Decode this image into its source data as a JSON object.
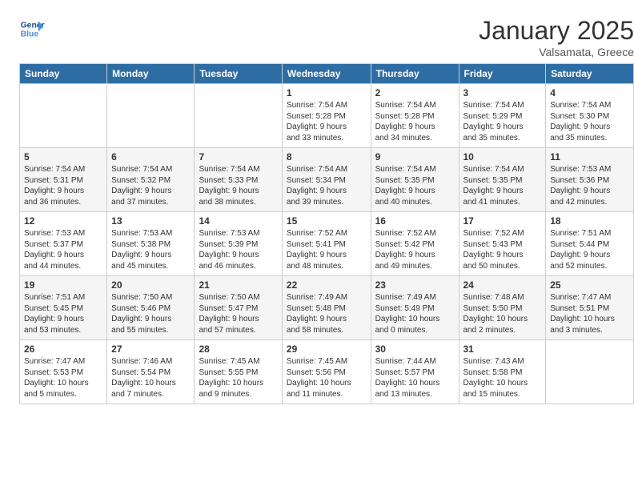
{
  "header": {
    "logo_line1": "General",
    "logo_line2": "Blue",
    "month": "January 2025",
    "location": "Valsamata, Greece"
  },
  "weekdays": [
    "Sunday",
    "Monday",
    "Tuesday",
    "Wednesday",
    "Thursday",
    "Friday",
    "Saturday"
  ],
  "weeks": [
    [
      {
        "day": "",
        "info": ""
      },
      {
        "day": "",
        "info": ""
      },
      {
        "day": "",
        "info": ""
      },
      {
        "day": "1",
        "info": "Sunrise: 7:54 AM\nSunset: 5:28 PM\nDaylight: 9 hours\nand 33 minutes."
      },
      {
        "day": "2",
        "info": "Sunrise: 7:54 AM\nSunset: 5:28 PM\nDaylight: 9 hours\nand 34 minutes."
      },
      {
        "day": "3",
        "info": "Sunrise: 7:54 AM\nSunset: 5:29 PM\nDaylight: 9 hours\nand 35 minutes."
      },
      {
        "day": "4",
        "info": "Sunrise: 7:54 AM\nSunset: 5:30 PM\nDaylight: 9 hours\nand 35 minutes."
      }
    ],
    [
      {
        "day": "5",
        "info": "Sunrise: 7:54 AM\nSunset: 5:31 PM\nDaylight: 9 hours\nand 36 minutes."
      },
      {
        "day": "6",
        "info": "Sunrise: 7:54 AM\nSunset: 5:32 PM\nDaylight: 9 hours\nand 37 minutes."
      },
      {
        "day": "7",
        "info": "Sunrise: 7:54 AM\nSunset: 5:33 PM\nDaylight: 9 hours\nand 38 minutes."
      },
      {
        "day": "8",
        "info": "Sunrise: 7:54 AM\nSunset: 5:34 PM\nDaylight: 9 hours\nand 39 minutes."
      },
      {
        "day": "9",
        "info": "Sunrise: 7:54 AM\nSunset: 5:35 PM\nDaylight: 9 hours\nand 40 minutes."
      },
      {
        "day": "10",
        "info": "Sunrise: 7:54 AM\nSunset: 5:35 PM\nDaylight: 9 hours\nand 41 minutes."
      },
      {
        "day": "11",
        "info": "Sunrise: 7:53 AM\nSunset: 5:36 PM\nDaylight: 9 hours\nand 42 minutes."
      }
    ],
    [
      {
        "day": "12",
        "info": "Sunrise: 7:53 AM\nSunset: 5:37 PM\nDaylight: 9 hours\nand 44 minutes."
      },
      {
        "day": "13",
        "info": "Sunrise: 7:53 AM\nSunset: 5:38 PM\nDaylight: 9 hours\nand 45 minutes."
      },
      {
        "day": "14",
        "info": "Sunrise: 7:53 AM\nSunset: 5:39 PM\nDaylight: 9 hours\nand 46 minutes."
      },
      {
        "day": "15",
        "info": "Sunrise: 7:52 AM\nSunset: 5:41 PM\nDaylight: 9 hours\nand 48 minutes."
      },
      {
        "day": "16",
        "info": "Sunrise: 7:52 AM\nSunset: 5:42 PM\nDaylight: 9 hours\nand 49 minutes."
      },
      {
        "day": "17",
        "info": "Sunrise: 7:52 AM\nSunset: 5:43 PM\nDaylight: 9 hours\nand 50 minutes."
      },
      {
        "day": "18",
        "info": "Sunrise: 7:51 AM\nSunset: 5:44 PM\nDaylight: 9 hours\nand 52 minutes."
      }
    ],
    [
      {
        "day": "19",
        "info": "Sunrise: 7:51 AM\nSunset: 5:45 PM\nDaylight: 9 hours\nand 53 minutes."
      },
      {
        "day": "20",
        "info": "Sunrise: 7:50 AM\nSunset: 5:46 PM\nDaylight: 9 hours\nand 55 minutes."
      },
      {
        "day": "21",
        "info": "Sunrise: 7:50 AM\nSunset: 5:47 PM\nDaylight: 9 hours\nand 57 minutes."
      },
      {
        "day": "22",
        "info": "Sunrise: 7:49 AM\nSunset: 5:48 PM\nDaylight: 9 hours\nand 58 minutes."
      },
      {
        "day": "23",
        "info": "Sunrise: 7:49 AM\nSunset: 5:49 PM\nDaylight: 10 hours\nand 0 minutes."
      },
      {
        "day": "24",
        "info": "Sunrise: 7:48 AM\nSunset: 5:50 PM\nDaylight: 10 hours\nand 2 minutes."
      },
      {
        "day": "25",
        "info": "Sunrise: 7:47 AM\nSunset: 5:51 PM\nDaylight: 10 hours\nand 3 minutes."
      }
    ],
    [
      {
        "day": "26",
        "info": "Sunrise: 7:47 AM\nSunset: 5:53 PM\nDaylight: 10 hours\nand 5 minutes."
      },
      {
        "day": "27",
        "info": "Sunrise: 7:46 AM\nSunset: 5:54 PM\nDaylight: 10 hours\nand 7 minutes."
      },
      {
        "day": "28",
        "info": "Sunrise: 7:45 AM\nSunset: 5:55 PM\nDaylight: 10 hours\nand 9 minutes."
      },
      {
        "day": "29",
        "info": "Sunrise: 7:45 AM\nSunset: 5:56 PM\nDaylight: 10 hours\nand 11 minutes."
      },
      {
        "day": "30",
        "info": "Sunrise: 7:44 AM\nSunset: 5:57 PM\nDaylight: 10 hours\nand 13 minutes."
      },
      {
        "day": "31",
        "info": "Sunrise: 7:43 AM\nSunset: 5:58 PM\nDaylight: 10 hours\nand 15 minutes."
      },
      {
        "day": "",
        "info": ""
      }
    ]
  ]
}
